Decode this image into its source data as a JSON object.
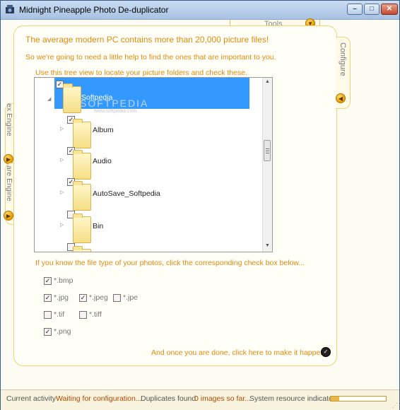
{
  "window": {
    "title": "Midnight Pineapple Photo De-duplicator"
  },
  "tabs": {
    "tools": "Tools",
    "configure": "Configure",
    "index_engine": "ex Engine",
    "compare_engine": "are Engine"
  },
  "intro": {
    "headline": "The average modern PC contains more than 20,000 picture files!",
    "subline": "So we're going to need a little help to find the ones that are important to you.",
    "tree_instruction": "Use this tree view to locate your picture folders and check these."
  },
  "tree": {
    "watermark": "SOFTPEDIA",
    "watermark_url": "www.softpedia.com",
    "nodes": [
      {
        "label": "Softpedia",
        "checked": true,
        "expanded": true,
        "selected": true
      },
      {
        "label": "Album",
        "checked": true
      },
      {
        "label": "Audio",
        "checked": true
      },
      {
        "label": "AutoSave_Softpedia",
        "checked": true
      },
      {
        "label": "Bin",
        "checked": false
      },
      {
        "label": "",
        "checked": false
      }
    ]
  },
  "filetypes": {
    "hint": "If you know the file type of your photos, click the corresponding check box below...",
    "items": [
      {
        "label": "*.bmp",
        "checked": true
      },
      {
        "label": "*.jpg",
        "checked": true
      },
      {
        "label": "*.jpeg",
        "checked": true
      },
      {
        "label": "*.jpe",
        "checked": false
      },
      {
        "label": "*.tif",
        "checked": false
      },
      {
        "label": "*.tiff",
        "checked": false
      },
      {
        "label": "*.png",
        "checked": true
      }
    ]
  },
  "done": {
    "text": "And once you are done, click here to make it happen"
  },
  "status": {
    "activity_label": "Current activity",
    "activity_value": "Waiting for configuration...",
    "duplicates_label": "Duplicates found",
    "duplicates_value": "0 images so far...",
    "resource_label": "System resource indicator",
    "resource_level": 0.15
  },
  "colors": {
    "accent": "#e08b10",
    "selection": "#3399ff"
  }
}
